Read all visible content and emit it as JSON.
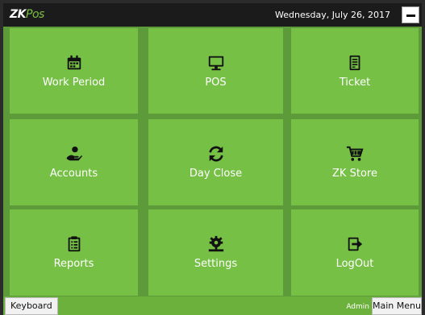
{
  "app": {
    "logo_main": "ZK",
    "logo_sub": "Pos"
  },
  "header": {
    "date": "Wednesday, July 26, 2017"
  },
  "tiles": [
    {
      "label": "Work Period",
      "icon": "calendar-icon"
    },
    {
      "label": "POS",
      "icon": "monitor-icon"
    },
    {
      "label": "Ticket",
      "icon": "ticket-icon"
    },
    {
      "label": "Accounts",
      "icon": "money-hand-icon"
    },
    {
      "label": "Day Close",
      "icon": "refresh-icon"
    },
    {
      "label": "ZK Store",
      "icon": "cart-icon"
    },
    {
      "label": "Reports",
      "icon": "clipboard-icon"
    },
    {
      "label": "Settings",
      "icon": "gear-icon"
    },
    {
      "label": "LogOut",
      "icon": "logout-icon"
    }
  ],
  "footer": {
    "keyboard_label": "Keyboard",
    "user": "Admin",
    "main_menu_label": "Main Menu"
  },
  "colors": {
    "tile": "#76c046",
    "background": "#5c9a3a",
    "topbar": "#1b1b1b"
  }
}
